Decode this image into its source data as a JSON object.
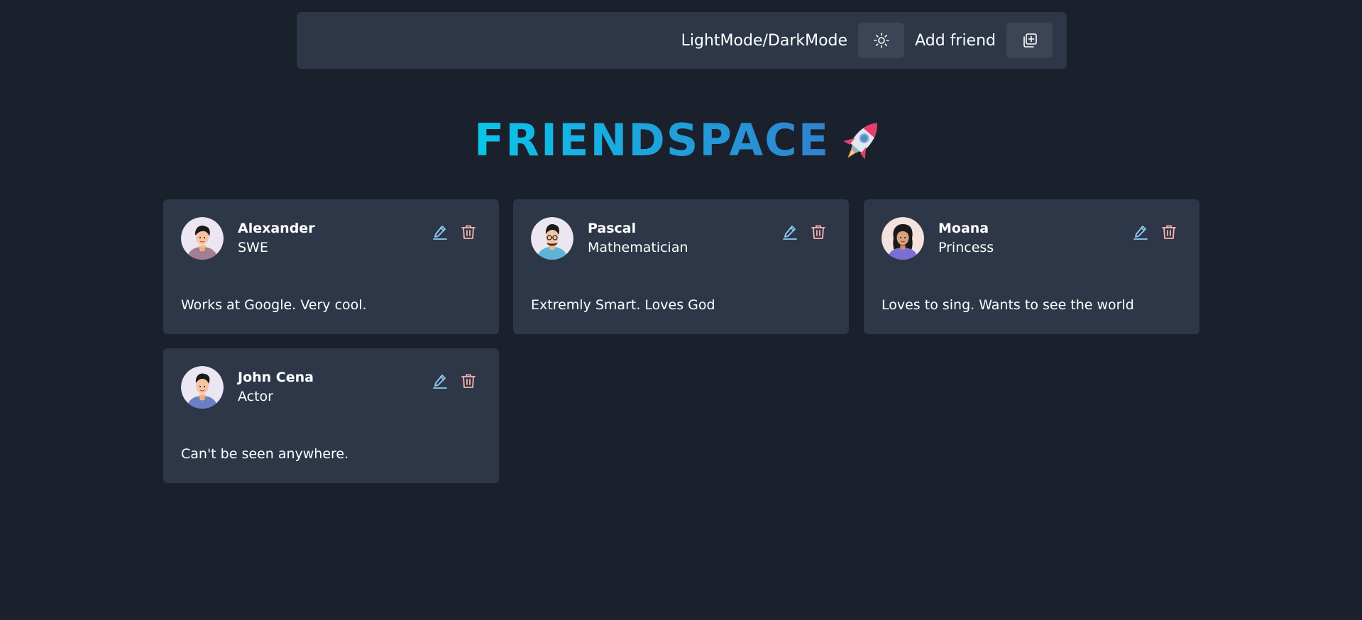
{
  "header": {
    "theme_toggle_label": "LightMode/DarkMode",
    "theme_toggle_icon": "sun-icon",
    "add_friend_label": "Add friend",
    "add_friend_icon": "add-square-icon"
  },
  "title": {
    "text": "FRIENDSPACE",
    "emoji": "rocket-icon",
    "gradient_from": "#0bc5ea",
    "gradient_to": "#3182ce"
  },
  "colors": {
    "background": "#1a202c",
    "card": "#2d3748",
    "edit_icon": "#90cdf4",
    "delete_icon": "#feb2b2"
  },
  "friends": [
    {
      "name": "Alexander",
      "job": "SWE",
      "description": "Works at Google. Very cool.",
      "avatar": "man-avatar-icon"
    },
    {
      "name": "Pascal",
      "job": "Mathematician",
      "description": "Extremly Smart. Loves God",
      "avatar": "man-with-glasses-avatar-icon"
    },
    {
      "name": "Moana",
      "job": "Princess",
      "description": "Loves to sing. Wants to see the world",
      "avatar": "woman-avatar-icon"
    },
    {
      "name": "John Cena",
      "job": "Actor",
      "description": "Can't be seen anywhere.",
      "avatar": "man-avatar-icon"
    }
  ]
}
